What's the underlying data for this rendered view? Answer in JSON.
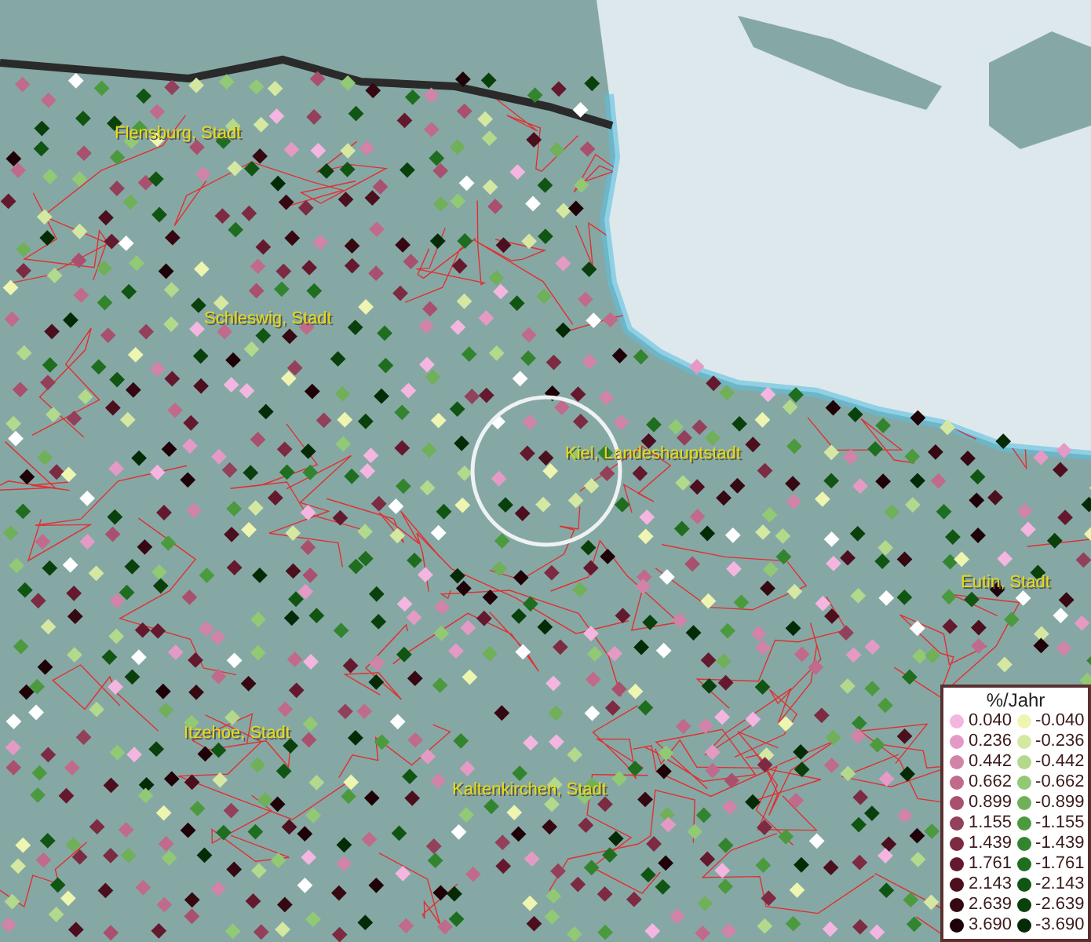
{
  "map": {
    "places": [
      {
        "name": "Flensburg, Stadt"
      },
      {
        "name": "Schleswig, Stadt"
      },
      {
        "name": "Kiel, Landeshauptstadt"
      },
      {
        "name": "Eutin, Stadt"
      },
      {
        "name": "Itzehoe, Stadt"
      },
      {
        "name": "Kaltenkirchen, Stadt"
      }
    ]
  },
  "legend": {
    "title": "%/Jahr",
    "columns": [
      [
        {
          "label": "0.040",
          "color": "#f4b6e0"
        },
        {
          "label": "0.236",
          "color": "#e59ac6"
        },
        {
          "label": "0.442",
          "color": "#d283a8"
        },
        {
          "label": "0.662",
          "color": "#c06b8c"
        },
        {
          "label": "0.899",
          "color": "#a9506f"
        },
        {
          "label": "1.155",
          "color": "#93405a"
        },
        {
          "label": "1.439",
          "color": "#7c2b42"
        },
        {
          "label": "1.761",
          "color": "#65192e"
        },
        {
          "label": "2.143",
          "color": "#4c0f1e"
        },
        {
          "label": "2.639",
          "color": "#350812"
        },
        {
          "label": "3.690",
          "color": "#1f0208"
        }
      ],
      [
        {
          "label": "-0.040",
          "color": "#eef5b0"
        },
        {
          "label": "-0.236",
          "color": "#d4e8a2"
        },
        {
          "label": "-0.442",
          "color": "#b3d98c"
        },
        {
          "label": "-0.662",
          "color": "#92c974"
        },
        {
          "label": "-0.899",
          "color": "#6fb058"
        },
        {
          "label": "-1.155",
          "color": "#4c9a3e"
        },
        {
          "label": "-1.439",
          "color": "#32852e"
        },
        {
          "label": "-1.761",
          "color": "#1f6e1f"
        },
        {
          "label": "-2.143",
          "color": "#115512"
        },
        {
          "label": "-2.639",
          "color": "#0a400c"
        },
        {
          "label": "-3.690",
          "color": "#052a06"
        }
      ]
    ]
  }
}
